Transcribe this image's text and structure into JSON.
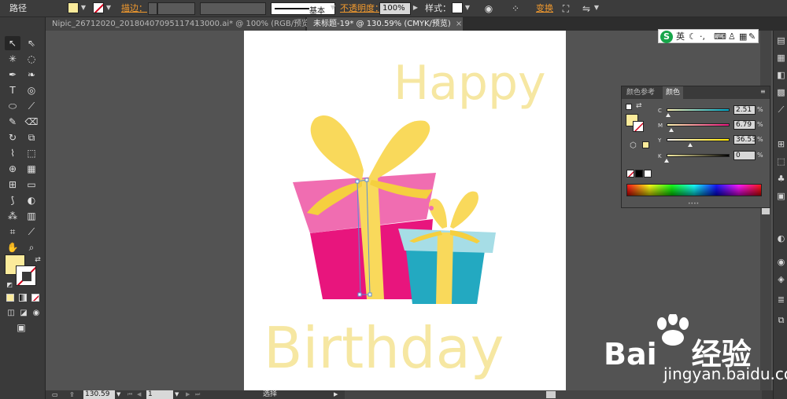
{
  "app": {
    "object_label": "路径",
    "stroke_label": "描边：",
    "stroke_profile": "基本",
    "opacity_label": "不透明度：",
    "opacity_value": "100%",
    "style_label": "样式：",
    "transform_label": "变换"
  },
  "tabs": [
    {
      "label": "Nipic_26712020_20180407095117413000.ai* @ 100% (RGB/预览)",
      "close": "×",
      "active": false
    },
    {
      "label": "未标题-19* @ 130.59% (CMYK/预览)",
      "close": "×",
      "active": true
    }
  ],
  "artwork": {
    "title_top": "Happy",
    "title_bottom": "Birthday"
  },
  "color_panel": {
    "tab_guide": "颜色参考",
    "tab_color": "颜色",
    "channels": [
      {
        "name": "C",
        "value": "2.51",
        "fraction": 0.03,
        "gradient": "linear-gradient(to right,#fff3b5,#00a8c8)"
      },
      {
        "name": "M",
        "value": "6.79",
        "fraction": 0.07,
        "gradient": "linear-gradient(to right,#fbf7b0,#e8157d)"
      },
      {
        "name": "Y",
        "value": "36.53",
        "fraction": 0.37,
        "gradient": "linear-gradient(to right,#f6f2f2,#ffe600)"
      },
      {
        "name": "K",
        "value": "0",
        "fraction": 0.0,
        "gradient": "linear-gradient(to right,#fbf1a6,#000000)"
      }
    ],
    "percent": "%"
  },
  "status": {
    "zoom": "130.59",
    "page": "1",
    "tool": "选择"
  },
  "ime": {
    "logo": "S",
    "lang": "英"
  },
  "watermark": {
    "brand": "Bai",
    "brand_suffix": "经验",
    "url": "jingyan.baidu.com"
  },
  "colors": {
    "fill": "#fbeb9b",
    "pink": "#e8157d",
    "pink_light": "#f06db1",
    "ribbon": "#f9d95b",
    "teal": "#23a9c1",
    "teal_light": "#a6dde6",
    "accent": "#f29a2e"
  }
}
